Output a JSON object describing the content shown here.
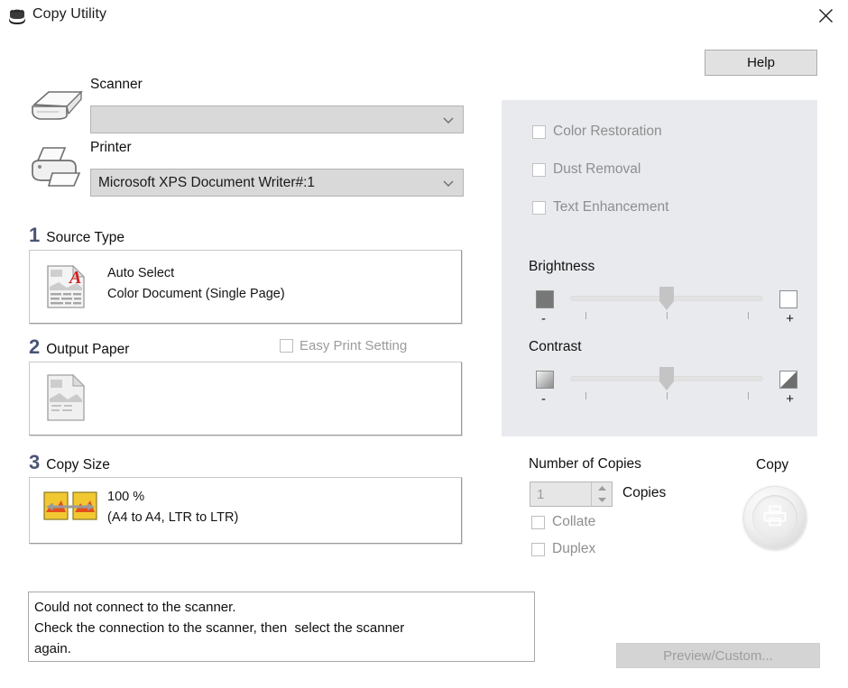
{
  "window": {
    "title": "Copy Utility",
    "icon": "copier-icon",
    "close_icon": "close-icon"
  },
  "toolbar": {
    "help_label": "Help"
  },
  "devices": {
    "scanner_label": "Scanner",
    "scanner_icon": "scanner-icon",
    "scanner_value": "",
    "printer_label": "Printer",
    "printer_icon": "printer-icon",
    "printer_value": "Microsoft XPS Document Writer#:1",
    "chevron_icon": "chevron-down-icon"
  },
  "steps": {
    "source": {
      "number": "1",
      "title": "Source Type",
      "icon": "color-document-icon",
      "line1": "Auto Select",
      "line2": "Color Document (Single Page)"
    },
    "output": {
      "number": "2",
      "title": "Output Paper",
      "icon": "blank-paper-icon",
      "line1": "",
      "line2": ""
    },
    "copysize": {
      "number": "3",
      "title": "Copy Size",
      "icon": "resize-images-icon",
      "line1": "100 %",
      "line2": "(A4 to A4, LTR to LTR)"
    }
  },
  "easy_print": {
    "label": "Easy Print Setting",
    "checked": false,
    "enabled": false
  },
  "image_settings": {
    "checkboxes": [
      {
        "name": "color-restoration",
        "label": "Color Restoration",
        "checked": false,
        "enabled": false
      },
      {
        "name": "dust-removal",
        "label": "Dust Removal",
        "checked": false,
        "enabled": false
      },
      {
        "name": "text-enhancement",
        "label": "Text Enhancement",
        "checked": false,
        "enabled": false
      }
    ],
    "brightness": {
      "label": "Brightness",
      "value": 50,
      "minus": "-",
      "plus": "+",
      "left_icon": "dark-square-icon",
      "right_icon": "light-square-icon"
    },
    "contrast": {
      "label": "Contrast",
      "value": 50,
      "minus": "-",
      "plus": "+",
      "left_icon": "gradient-square-icon",
      "right_icon": "contrast-split-icon"
    }
  },
  "copies": {
    "heading": "Number of Copies",
    "value": "1",
    "unit_label": "Copies",
    "enabled": false,
    "collate": {
      "label": "Collate",
      "checked": false,
      "enabled": false
    },
    "duplex": {
      "label": "Duplex",
      "checked": false,
      "enabled": false
    }
  },
  "copy_action": {
    "label": "Copy",
    "icon": "printer-icon"
  },
  "status": {
    "line1": "Could not connect to the scanner.",
    "line2": "Check the connection to the scanner, then  select the scanner",
    "line3": "again."
  },
  "preview": {
    "label": "Preview/Custom...",
    "enabled": false
  },
  "colors": {
    "panel_bg": "#e8eaee",
    "step_number": "#4a5575",
    "disabled_text": "#8e8e8e",
    "combo_bg": "#d9d9d9"
  }
}
